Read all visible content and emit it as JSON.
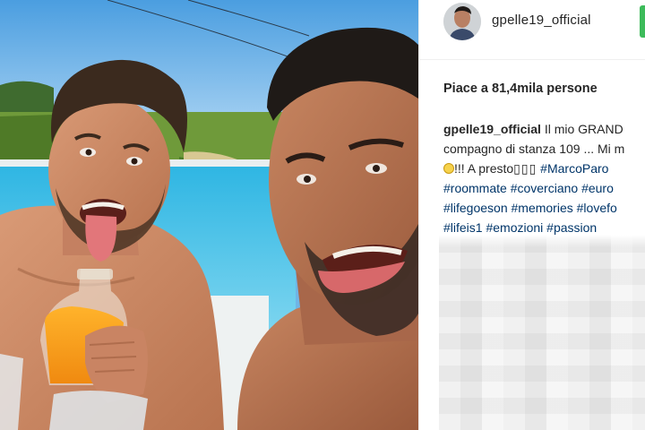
{
  "post": {
    "username": "gpelle19_official",
    "likes_text": "Piace a 81,4mila persone",
    "caption": {
      "username": "gpelle19_official",
      "line1_text": "Il mio GRAND",
      "line2_text": "compagno di stanza 109 ... Mi m",
      "line3_text": "!!! A presto",
      "line3_boxes": "▯▯▯",
      "line3_tag": "#MarcoParo",
      "line4_tags": "#roommate #coverciano #euro",
      "line5_tags": "#lifegoeson #memories #lovefo",
      "line6_tags": "#lifeis1 #emozioni #passion"
    }
  },
  "colors": {
    "follow_button": "#3dbb5a",
    "hashtag": "#003569",
    "text": "#262626"
  },
  "icons": {
    "emoji": "smiling-face-emoji"
  }
}
